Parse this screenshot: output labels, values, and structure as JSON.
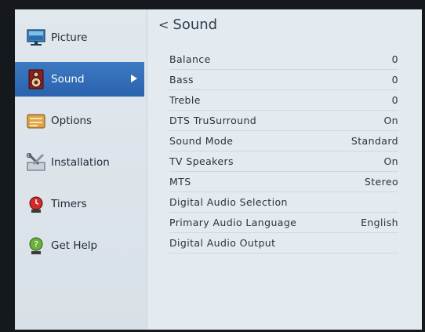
{
  "sidebar": {
    "items": [
      {
        "label": "Picture",
        "icon": "picture-icon"
      },
      {
        "label": "Sound",
        "icon": "speaker-icon",
        "active": true
      },
      {
        "label": "Options",
        "icon": "options-icon"
      },
      {
        "label": "Installation",
        "icon": "installation-icon"
      },
      {
        "label": "Timers",
        "icon": "timer-icon"
      },
      {
        "label": "Get Help",
        "icon": "help-icon"
      }
    ]
  },
  "main": {
    "back_symbol": "<",
    "title": "Sound",
    "rows": [
      {
        "label": "Balance",
        "value": "0"
      },
      {
        "label": "Bass",
        "value": "0"
      },
      {
        "label": "Treble",
        "value": "0"
      },
      {
        "label": "DTS TruSurround",
        "value": "On"
      },
      {
        "label": "Sound Mode",
        "value": "Standard"
      },
      {
        "label": "TV Speakers",
        "value": "On"
      },
      {
        "label": "MTS",
        "value": "Stereo"
      },
      {
        "label": "Digital Audio Selection",
        "value": ""
      },
      {
        "label": "Primary Audio Language",
        "value": "English"
      },
      {
        "label": "Digital Audio Output",
        "value": ""
      }
    ]
  },
  "colors": {
    "accent": "#2f6ab3",
    "background": "#e3ebf1",
    "bezel": "#15181c"
  }
}
